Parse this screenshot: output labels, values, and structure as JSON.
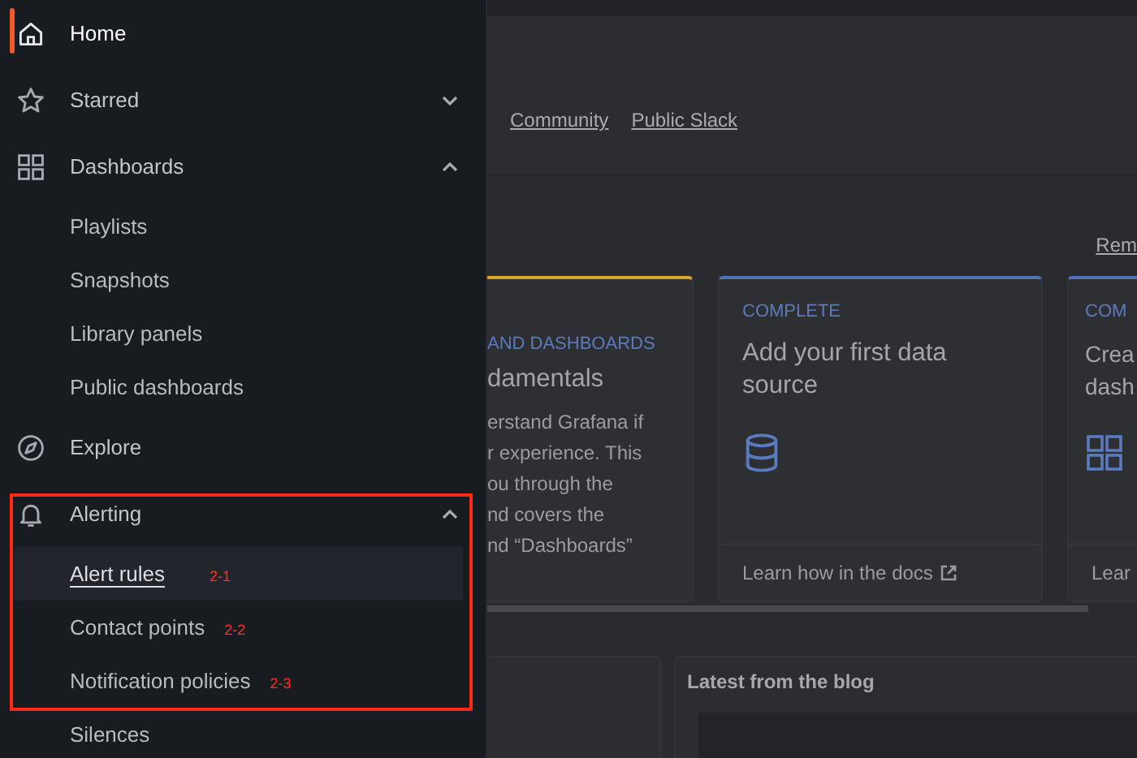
{
  "sidebar": {
    "items": [
      {
        "label": "Home",
        "kind": "link",
        "selected": true,
        "highlighted": false
      },
      {
        "label": "Starred",
        "kind": "group",
        "selected": false,
        "expanded": false,
        "highlighted": false
      },
      {
        "label": "Dashboards",
        "kind": "group",
        "selected": false,
        "expanded": true,
        "highlighted": false,
        "children": [
          {
            "label": "Playlists",
            "selected": false,
            "highlighted": false
          },
          {
            "label": "Snapshots",
            "selected": false,
            "highlighted": false
          },
          {
            "label": "Library panels",
            "selected": false,
            "highlighted": false
          },
          {
            "label": "Public dashboards",
            "selected": false,
            "highlighted": false
          }
        ]
      },
      {
        "label": "Explore",
        "kind": "link",
        "selected": false,
        "highlighted": false
      },
      {
        "label": "Alerting",
        "kind": "group",
        "selected": false,
        "expanded": true,
        "highlighted": true,
        "children": [
          {
            "label": "Alert rules",
            "selected": true,
            "highlighted": true,
            "annotation": "2-1"
          },
          {
            "label": "Contact points",
            "selected": false,
            "highlighted": true,
            "annotation": "2-2"
          },
          {
            "label": "Notification policies",
            "selected": false,
            "highlighted": true,
            "annotation": "2-3"
          },
          {
            "label": "Silences",
            "selected": false,
            "highlighted": false
          }
        ]
      }
    ]
  },
  "main": {
    "links": [
      "Community",
      "Public Slack"
    ],
    "section_link": "Rem",
    "cards": [
      {
        "status": "AND DASHBOARDS",
        "color": "#d9a531",
        "title_lines": [
          "damentals"
        ],
        "body_lines": [
          "erstand Grafana if",
          "r experience. This",
          "ou through the",
          "nd covers the",
          "nd “Dashboards”"
        ]
      },
      {
        "status": "COMPLETE",
        "color": "#4f73b3",
        "title_lines": [
          "Add your first data",
          "source"
        ],
        "footer": "Learn how in the docs"
      },
      {
        "status": "COM",
        "color": "#4f73b3",
        "title_lines": [
          "Crea",
          "dash"
        ],
        "footer": "Lear"
      }
    ],
    "blog_panel": {
      "title": "Latest from the blog"
    }
  }
}
